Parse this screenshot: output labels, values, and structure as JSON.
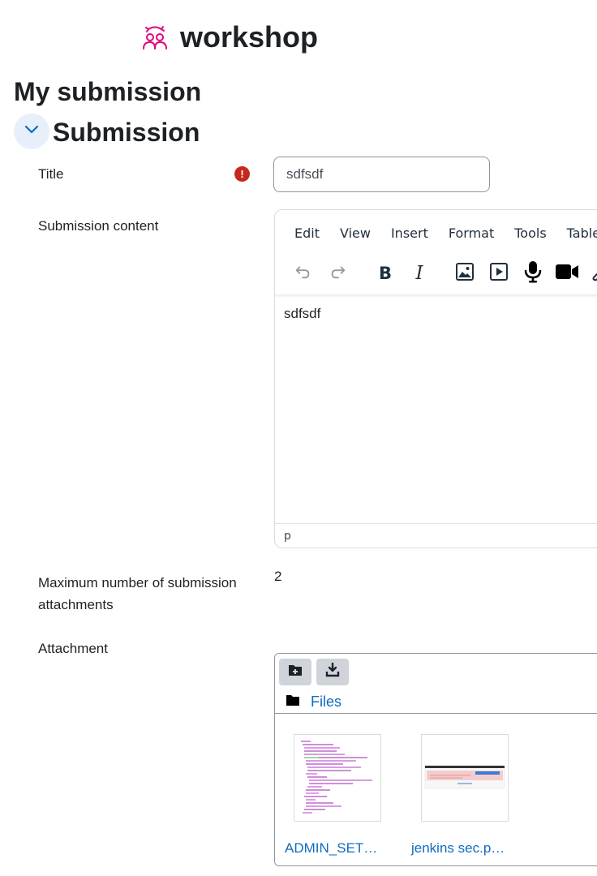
{
  "header": {
    "title": "workshop",
    "icon": "workshop-icon",
    "icon_color": "#e6007e"
  },
  "page": {
    "heading": "My submission"
  },
  "section": {
    "heading": "Submission",
    "collapse_icon": "chevron-down-icon"
  },
  "form": {
    "title_label": "Title",
    "title_value": "sdfsdf",
    "content_label": "Submission content",
    "max_attachments_label": "Maximum number of submission attachments",
    "max_attachments_value": "2",
    "attachment_label": "Attachment"
  },
  "editor": {
    "menu": [
      "Edit",
      "View",
      "Insert",
      "Format",
      "Tools",
      "Table"
    ],
    "toolbar": [
      "undo-icon",
      "redo-icon",
      "bold-icon",
      "italic-icon",
      "image-icon",
      "media-icon",
      "microphone-icon",
      "video-camera-icon",
      "link-icon"
    ],
    "content": "sdfsdf",
    "status_path": "p"
  },
  "filemanager": {
    "path_label": "Files",
    "files": [
      {
        "name": "ADMIN_SET…"
      },
      {
        "name": "jenkins sec.p…"
      }
    ]
  },
  "colors": {
    "accent": "#0f6cbf",
    "required": "#c5281c",
    "brand": "#e6007e"
  }
}
